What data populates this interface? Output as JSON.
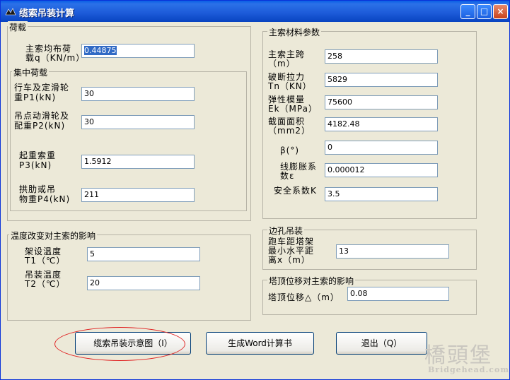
{
  "window": {
    "title": "缆索吊装计算",
    "minimize": "_",
    "maximize": "□",
    "close": "×"
  },
  "load_group": {
    "title": "荷载",
    "q_label_1": "主索均布荷",
    "q_label_2": "载q（KN/m）",
    "q_value": "0.44875",
    "concentrated": {
      "title": "集中荷载",
      "p1_label_1": "行车及定滑轮",
      "p1_label_2": "重P1(kN)",
      "p1_value": "30",
      "p2_label_1": "吊点动滑轮及",
      "p2_label_2": "配重P2(kN)",
      "p2_value": "30",
      "p3_label_1": "起重索重",
      "p3_label_2": "P3(kN)",
      "p3_value": "1.5912",
      "p4_label_1": "拱肋或吊",
      "p4_label_2": "物重P4(kN)",
      "p4_value": "211"
    }
  },
  "material_group": {
    "title": "主索材料参数",
    "span_label_1": "主索主跨",
    "span_label_2": "（m）",
    "span_value": "258",
    "tn_label_1": "破断拉力",
    "tn_label_2": "Tn（KN）",
    "tn_value": "5829",
    "ek_label_1": "弹性模量",
    "ek_label_2": "Ek（MPa）",
    "ek_value": "75600",
    "area_label_1": "截面面积",
    "area_label_2": "（mm2）",
    "area_value": "4182.48",
    "beta_label": "β(°)",
    "beta_value": "0",
    "exp_label_1": "线膨胀系",
    "exp_label_2": "数ε",
    "exp_value": "0.000012",
    "k_label": "安全系数K",
    "k_value": "3.5"
  },
  "temp_group": {
    "title": "温度改变对主索的影响",
    "t1_label_1": "架设温度",
    "t1_label_2": "T1（℃）",
    "t1_value": "5",
    "t2_label_1": "吊装温度",
    "t2_label_2": "T2（℃）",
    "t2_value": "20"
  },
  "edge_group": {
    "title": "边孔吊装",
    "x_label_1": "跑车距塔架",
    "x_label_2": "最小水平距",
    "x_label_3": "离x（m）",
    "x_value": "13"
  },
  "tower_group": {
    "title": "塔顶位移对主索的影响",
    "delta_label": "塔顶位移△（m）",
    "delta_value": "0.08"
  },
  "buttons": {
    "diagram": "缆索吊装示意图（I）",
    "word": "生成Word计算书",
    "exit": "退出（Q）"
  },
  "watermark": {
    "brand": "橋頭堡",
    "site": "Bridgehead.com.cn"
  }
}
